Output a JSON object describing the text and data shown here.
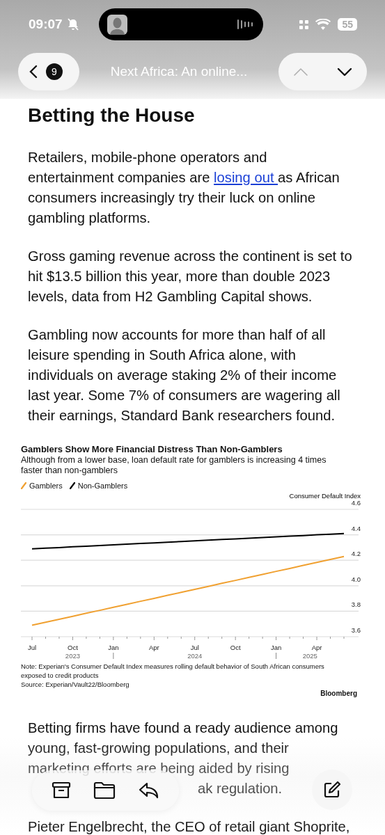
{
  "status_bar": {
    "time": "09:07",
    "battery": "55"
  },
  "nav": {
    "back_count": "9",
    "title": "Next Africa: An online...",
    "buttons": [
      {
        "kind": "up",
        "disabled": true
      },
      {
        "kind": "down",
        "disabled": false
      }
    ]
  },
  "heading": "Betting the House",
  "paragraphs": [
    {
      "parts": [
        {
          "kind": "text",
          "text": "Retailers, mobile-phone operators and entertainment companies are "
        },
        {
          "kind": "link",
          "text": "losing out "
        },
        {
          "kind": "text",
          "text": "as African consumers increasingly try their luck on online gambling platforms."
        }
      ]
    },
    {
      "parts": [
        {
          "kind": "text",
          "text": "Gross gaming revenue across the continent is set to hit $13.5 billion this year, more than double 2023 levels, data from H2 Gambling Capital shows."
        }
      ]
    },
    {
      "parts": [
        {
          "kind": "text",
          "text": "Gambling now accounts for more than half of all leisure spending in South Africa alone, with individuals on average staking 2% of their income last year. Some 7% of consumers are wagering all their earnings, Standard Bank researchers found."
        }
      ]
    }
  ],
  "chart": {
    "title": "Gamblers Show More Financial Distress Than Non-Gamblers",
    "subtitle": "Although from a lower base, loan default rate for gamblers is increasing 4 times faster than non-gamblers",
    "year_labels": [
      "2023",
      "2024",
      "2025"
    ],
    "note": "Note: Experian's Consumer Default Index measures rolling default behavior of South African consumers exposed to credit products",
    "source": "Source: Experian/Vault22/Bloomberg",
    "brand": "Bloomberg",
    "chart_data": {
      "type": "line",
      "ylabel": "Consumer Default Index",
      "categories": [
        "Jul",
        null,
        null,
        "Oct",
        null,
        null,
        "Jan",
        null,
        null,
        "Apr",
        null,
        null,
        "Jul",
        null,
        null,
        "Oct",
        null,
        null,
        "Jan",
        null,
        null,
        "Apr",
        null,
        null
      ],
      "series": [
        {
          "name": "Gamblers",
          "color": "#f0a030",
          "values": [
            3.69,
            3.713,
            3.737,
            3.76,
            3.784,
            3.807,
            3.831,
            3.854,
            3.878,
            3.901,
            3.925,
            3.948,
            3.972,
            3.995,
            4.019,
            4.042,
            4.066,
            4.089,
            4.113,
            4.136,
            4.16,
            4.183,
            4.207,
            4.23
          ]
        },
        {
          "name": "Non-Gamblers",
          "color": "#000000",
          "values": [
            4.29,
            4.295,
            4.3,
            4.306,
            4.311,
            4.316,
            4.321,
            4.327,
            4.332,
            4.337,
            4.342,
            4.347,
            4.353,
            4.358,
            4.363,
            4.368,
            4.373,
            4.379,
            4.384,
            4.389,
            4.394,
            4.4,
            4.405,
            4.41
          ]
        }
      ],
      "grid": true,
      "ylim": [
        3.6,
        4.6
      ],
      "yticks": [
        {
          "value": 3.6,
          "label": "3.6"
        },
        {
          "value": 3.8,
          "label": "3.8"
        },
        {
          "value": 4.0,
          "label": "4.0"
        },
        {
          "value": 4.2,
          "label": "4.2"
        },
        {
          "value": 4.4,
          "label": "4.4"
        },
        {
          "value": 4.6,
          "label": "4.6"
        }
      ]
    }
  },
  "paragraphs_after": [
    {
      "parts": [
        {
          "kind": "text",
          "text": "Betting firms have found a ready audience among young, fast-growing populations, and their marketing efforts are being aided by rising"
        }
      ]
    },
    {
      "kind": "fragment",
      "parts": [
        {
          "kind": "text",
          "text": "ak regulation."
        }
      ]
    },
    {
      "parts": [
        {
          "kind": "text",
          "text": "Pieter Engelbrecht, the CEO of retail giant Shoprite,"
        }
      ]
    }
  ]
}
